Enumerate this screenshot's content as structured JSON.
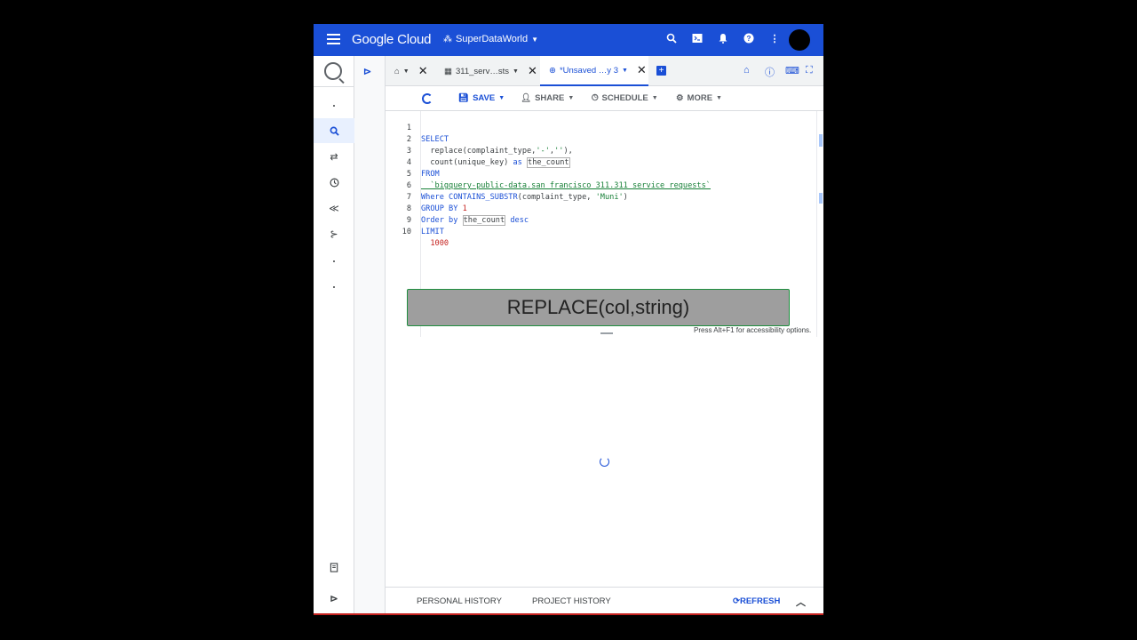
{
  "topbar": {
    "brand": "Google Cloud",
    "project": "SuperDataWorld"
  },
  "rail": {
    "items": [
      "dot",
      "search-icon",
      "transfers-icon",
      "history-icon",
      "analytics-icon",
      "pipelines-icon",
      "dot",
      "dot"
    ],
    "bottom_items": [
      "notes-icon",
      "expand-icon"
    ]
  },
  "tabs": [
    {
      "label": "",
      "type": "home"
    },
    {
      "label": "311_serv…sts",
      "type": "table"
    },
    {
      "label": "*Unsaved …y 3",
      "type": "query",
      "active": true
    }
  ],
  "toolbar": {
    "save": "SAVE",
    "share": "SHARE",
    "schedule": "SCHEDULE",
    "more": "MORE"
  },
  "editor": {
    "lines": [
      {
        "n": "1",
        "text": "SELECT"
      },
      {
        "n": "2",
        "text": "  replace(complaint_type,'-',''),",
        "highlight_parts": [
          "  replace(complaint_type,",
          "'-'",
          ",",
          "''",
          "),"
        ]
      },
      {
        "n": "3",
        "text": "  count(unique_key) as the_count"
      },
      {
        "n": "4",
        "text": "FROM"
      },
      {
        "n": "5",
        "text": "  `bigquery-public-data.san_francisco_311.311_service_requests`"
      },
      {
        "n": "6",
        "text": "Where CONTAINS_SUBSTR(complaint_type, 'Muni')"
      },
      {
        "n": "7",
        "text": "GROUP BY 1"
      },
      {
        "n": "8",
        "text": "Order by the_count desc"
      },
      {
        "n": "9",
        "text": "LIMIT"
      },
      {
        "n": "10",
        "text": "  1000"
      }
    ],
    "banner": "REPLACE(col,string)",
    "a11y_hint": "Press Alt+F1 for accessibility options."
  },
  "bottombar": {
    "personal": "PERSONAL HISTORY",
    "project": "PROJECT HISTORY",
    "refresh": "REFRESH"
  },
  "colors": {
    "brand_blue": "#1a4fd6",
    "string_green": "#188038",
    "number_red": "#c5221f"
  }
}
